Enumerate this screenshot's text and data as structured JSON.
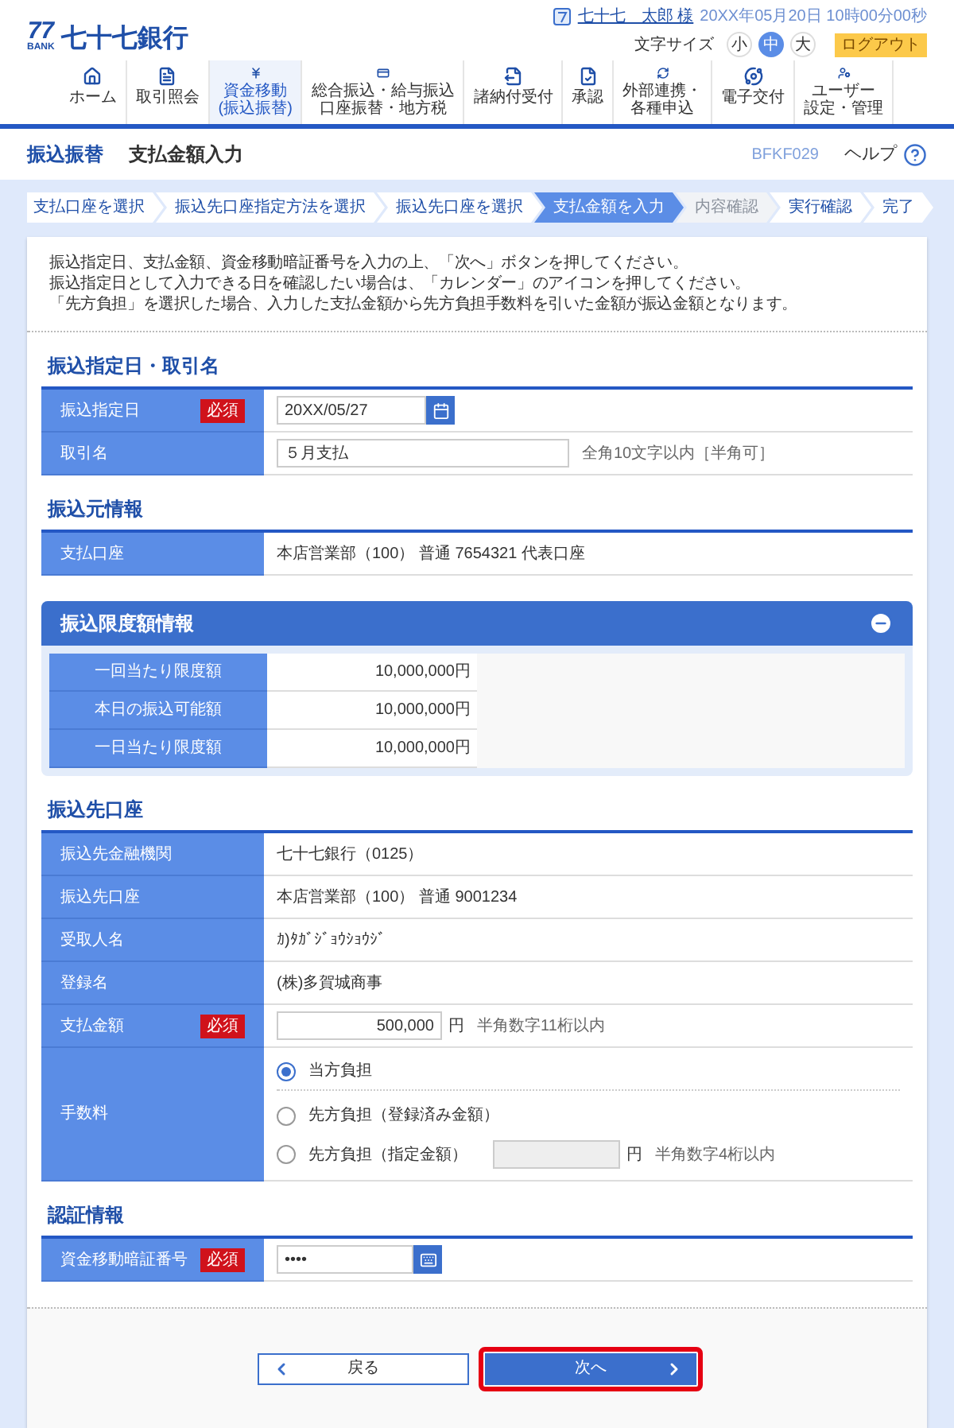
{
  "header": {
    "logo_number": "77",
    "logo_sub": "BANK",
    "logo_name": "七十七銀行",
    "user_name": "七十七　太郎 様",
    "datetime": "20XX年05月20日 10時00分00秒",
    "font_size_label": "文字サイズ",
    "font_sizes": [
      {
        "label": "小",
        "selected": false
      },
      {
        "label": "中",
        "selected": true
      },
      {
        "label": "大",
        "selected": false
      }
    ],
    "logout": "ログアウト"
  },
  "nav": [
    {
      "lines": [
        "ホーム"
      ],
      "selected": false
    },
    {
      "lines": [
        "取引照会"
      ],
      "selected": false
    },
    {
      "lines": [
        "資金移動",
        "(振込振替)"
      ],
      "selected": true
    },
    {
      "lines": [
        "総合振込・給与振込",
        "口座振替・地方税"
      ],
      "selected": false
    },
    {
      "lines": [
        "諸納付受付"
      ],
      "selected": false
    },
    {
      "lines": [
        "承認"
      ],
      "selected": false
    },
    {
      "lines": [
        "外部連携・",
        "各種申込"
      ],
      "selected": false
    },
    {
      "lines": [
        "電子交付"
      ],
      "selected": false
    },
    {
      "lines": [
        "ユーザー",
        "設定・管理"
      ],
      "selected": false
    }
  ],
  "page": {
    "category": "振込振替",
    "title": "支払金額入力",
    "screen_id": "BFKF029",
    "help": "ヘルプ"
  },
  "steps": [
    {
      "label": "支払口座を選択",
      "selected": false,
      "disabled": false
    },
    {
      "label": "振込先口座指定方法を選択",
      "selected": false,
      "disabled": false
    },
    {
      "label": "振込先口座を選択",
      "selected": false,
      "disabled": false
    },
    {
      "label": "支払金額を入力",
      "selected": true,
      "disabled": false
    },
    {
      "label": "内容確認",
      "selected": false,
      "disabled": true
    },
    {
      "label": "実行確認",
      "selected": false,
      "disabled": false
    },
    {
      "label": "完了",
      "selected": false,
      "disabled": false
    }
  ],
  "instructions": [
    "振込指定日、支払金額、資金移動暗証番号を入力の上、「次へ」ボタンを押してください。",
    "振込指定日として入力できる日を確認したい場合は、「カレンダー」のアイコンを押してください。",
    "「先方負担」を選択した場合、入力した支払金額から先方負担手数料を引いた金額が振込金額となります。"
  ],
  "sections": [
    {
      "kind": "form",
      "title": "振込指定日・取引名",
      "rows": [
        {
          "kind": "date",
          "label": "振込指定日",
          "badge": "必須",
          "value": "20XX/05/27"
        },
        {
          "kind": "input",
          "label": "取引名",
          "value": "５月支払",
          "hint": "全角10文字以内［半角可］"
        }
      ]
    },
    {
      "kind": "form",
      "title": "振込元情報",
      "rows": [
        {
          "kind": "text",
          "label": "支払口座",
          "value": "本店営業部（100） 普通 7654321 代表口座"
        }
      ]
    },
    {
      "kind": "panel",
      "title": "振込限度額情報",
      "expanded": true,
      "rows": [
        {
          "label": "一回当たり限度額",
          "value": "10,000,000円"
        },
        {
          "label": "本日の振込可能額",
          "value": "10,000,000円"
        },
        {
          "label": "一日当たり限度額",
          "value": "10,000,000円"
        }
      ]
    },
    {
      "kind": "form",
      "title": "振込先口座",
      "rows": [
        {
          "kind": "text",
          "label": "振込先金融機関",
          "value": "七十七銀行（0125）"
        },
        {
          "kind": "text",
          "label": "振込先口座",
          "value": "本店営業部（100） 普通 9001234"
        },
        {
          "kind": "text",
          "label": "受取人名",
          "value": "ｶ)ﾀｶﾞｼﾞｮｳｼｮｳｼﾞ"
        },
        {
          "kind": "text",
          "label": "登録名",
          "value": "(株)多賀城商事"
        },
        {
          "kind": "amount",
          "label": "支払金額",
          "badge": "必須",
          "value": "500,000",
          "unit": "円",
          "hint": "半角数字11桁以内"
        },
        {
          "kind": "radio",
          "label": "手数料",
          "options": [
            {
              "label": "当方負担",
              "selected": true
            },
            {
              "label": "先方負担（登録済み金額）",
              "selected": false
            },
            {
              "label": "先方負担（指定金額）",
              "selected": false,
              "field": {
                "disabled": true,
                "unit": "円",
                "hint": "半角数字4桁以内"
              }
            }
          ]
        }
      ]
    },
    {
      "kind": "form",
      "title": "認証情報",
      "rows": [
        {
          "kind": "password",
          "label": "資金移動暗証番号",
          "badge": "必須",
          "value": "••••"
        }
      ]
    }
  ],
  "buttons": [
    {
      "kind": "back",
      "label": "戻る",
      "highlighted": false
    },
    {
      "kind": "next",
      "label": "次へ",
      "highlighted": true
    }
  ]
}
